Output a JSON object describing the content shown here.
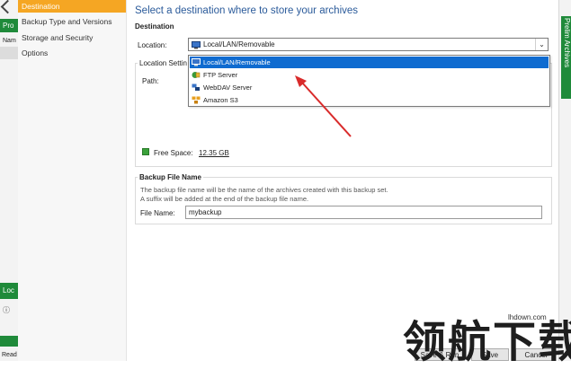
{
  "background": {
    "left_tab_label": "Pro",
    "left_column_label": "Nam",
    "left_panel_label": "Loc",
    "left_info_icon": "info-icon",
    "status_text": "Read",
    "right_vertical_text": "Prelim Archives"
  },
  "sidebar": {
    "items": [
      {
        "label": "Destination",
        "active": true
      },
      {
        "label": "Backup Type and Versions",
        "active": false
      },
      {
        "label": "Storage and Security",
        "active": false
      },
      {
        "label": "Options",
        "active": false
      }
    ]
  },
  "main": {
    "heading": "Select a destination where to store your archives",
    "destination_section": "Destination",
    "location_label": "Location:",
    "location_value": "Local/LAN/Removable",
    "location_settings_label": "Location Settin",
    "path_label": "Path:",
    "free_space_label": "Free Space:",
    "free_space_value": "12.35 GB",
    "dropdown_options": [
      {
        "label": "Local/LAN/Removable",
        "selected": true,
        "icon": "monitor-icon"
      },
      {
        "label": "FTP Server",
        "selected": false,
        "icon": "ftp-server-icon"
      },
      {
        "label": "WebDAV Server",
        "selected": false,
        "icon": "webdav-server-icon"
      },
      {
        "label": "Amazon S3",
        "selected": false,
        "icon": "amazon-s3-icon"
      }
    ],
    "backup_file_name_section": "Backup File Name",
    "backup_desc_line1": "The backup file name will be the name of the archives created with this backup set.",
    "backup_desc_line2": "A suffix will be added at the end of the backup file name.",
    "file_name_label": "File Name:",
    "file_name_value": "mybackup"
  },
  "footer": {
    "save_run_label": "Save & Run",
    "save_label": "Save",
    "cancel_label": "Cancel"
  },
  "watermark": {
    "chinese": "领航下载",
    "url": "lhdown.com"
  },
  "colors": {
    "accent_orange": "#f5a623",
    "selected_blue": "#0f6bd0",
    "heading_blue": "#2a5a9a",
    "app_green": "#1f8a3a",
    "annotation_red": "#d92b2b"
  }
}
